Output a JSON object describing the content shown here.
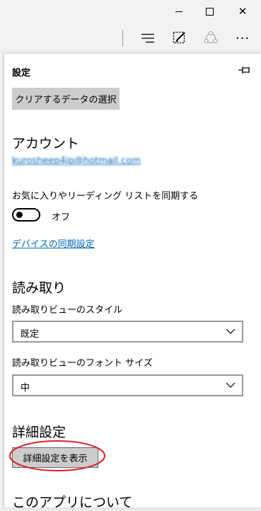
{
  "window": {
    "controls": {
      "minimize": "minimize-icon",
      "maximize": "maximize-icon",
      "close": "close-icon",
      "close_glyph": "✕"
    }
  },
  "toolbar": {
    "icons": [
      "hub-icon",
      "web-note-icon",
      "share-icon",
      "more-icon"
    ],
    "more_glyph": "···"
  },
  "settings": {
    "title": "設定",
    "clear_button": "クリアするデータの選択",
    "account": {
      "heading": "アカウント",
      "email": "kurosheep4jp@hotmail.com"
    },
    "sync": {
      "label": "お気に入りやリーディング リストを同期する",
      "toggle_state": "オフ",
      "device_sync_link": "デバイスの同期設定"
    },
    "reading": {
      "heading": "読み取り",
      "style_label": "読み取りビューのスタイル",
      "style_value": "既定",
      "font_label": "読み取りビューのフォント サイズ",
      "font_value": "中"
    },
    "advanced": {
      "heading": "詳細設定",
      "show_button": "詳細設定を表示"
    },
    "about": {
      "heading": "このアプリについて"
    }
  },
  "colors": {
    "link": "#0067b8",
    "highlight": "#d9202b",
    "button_bg": "#cccccc"
  }
}
